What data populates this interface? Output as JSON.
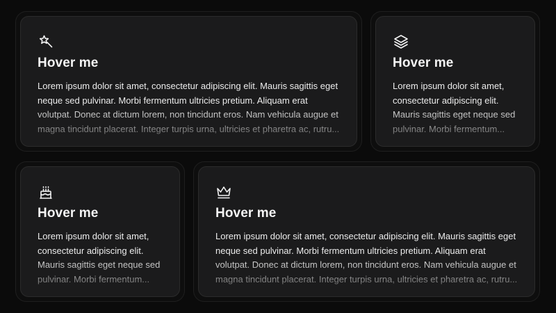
{
  "cards": [
    {
      "icon": "magic-wand-star-icon",
      "title": "Hover me",
      "description": "Lorem ipsum dolor sit amet, consectetur adipiscing elit. Mauris sagittis eget neque sed pulvinar. Morbi fermentum ultricies pretium. Aliquam erat volutpat. Donec at dictum lorem, non tincidunt eros. Nam vehicula augue et magna tincidunt placerat. Integer turpis urna, ultricies et pharetra ac, rutru..."
    },
    {
      "icon": "layers-icon",
      "title": "Hover me",
      "description": "Lorem ipsum dolor sit amet, consectetur adipiscing elit. Mauris sagittis eget neque sed pulvinar. Morbi fermentum..."
    },
    {
      "icon": "birthday-cake-icon",
      "title": "Hover me",
      "description": "Lorem ipsum dolor sit amet, consectetur adipiscing elit. Mauris sagittis eget neque sed pulvinar. Morbi fermentum..."
    },
    {
      "icon": "crown-icon",
      "title": "Hover me",
      "description": "Lorem ipsum dolor sit amet, consectetur adipiscing elit. Mauris sagittis eget neque sed pulvinar. Morbi fermentum ultricies pretium. Aliquam erat volutpat. Donec at dictum lorem, non tincidunt eros. Nam vehicula augue et magna tincidunt placerat. Integer turpis urna, ultricies et pharetra ac, rutru..."
    }
  ],
  "colors": {
    "background": "#0b0b0b",
    "card": "#1b1b1c",
    "text": "#ececec"
  }
}
